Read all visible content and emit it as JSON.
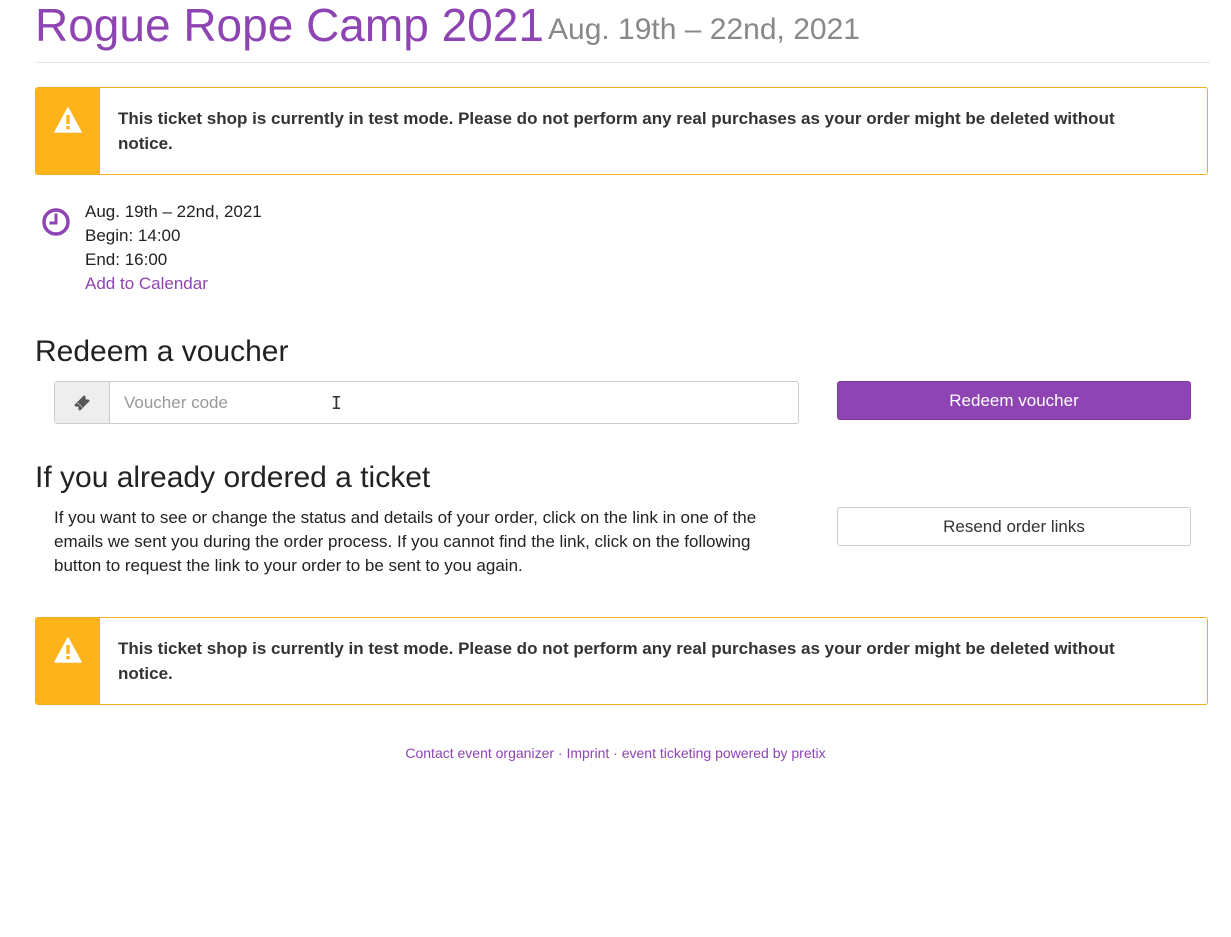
{
  "header": {
    "title": "Rogue Rope Camp 2021",
    "daterange": "Aug. 19th – 22nd, 2021"
  },
  "alerts": {
    "test_mode_message": "This ticket shop is currently in test mode. Please do not perform any real purchases as your order might be deleted without notice."
  },
  "event_info": {
    "date": "Aug. 19th – 22nd, 2021",
    "begin": "Begin: 14:00",
    "end": "End: 16:00",
    "calendar_link": "Add to Calendar"
  },
  "voucher": {
    "heading": "Redeem a voucher",
    "placeholder": "Voucher code",
    "button_label": "Redeem voucher"
  },
  "ordered": {
    "heading": "If you already ordered a ticket",
    "text": "If you want to see or change the status and details of your order, click on the link in one of the emails we sent you during the order process. If you cannot find the link, click on the following button to request the link to your order to be sent to you again.",
    "button_label": "Resend order links"
  },
  "footer": {
    "contact": "Contact event organizer",
    "imprint": "Imprint",
    "powered_by": "event ticketing powered by pretix",
    "separator": " · "
  },
  "colors": {
    "brand": "#8e44b3",
    "warning": "#fdb31a",
    "warning_border": "#f1b01d"
  },
  "icons": {
    "warning": "warning-triangle-icon",
    "clock": "clock-icon",
    "ticket": "ticket-icon",
    "cursor": "text-cursor-icon"
  }
}
